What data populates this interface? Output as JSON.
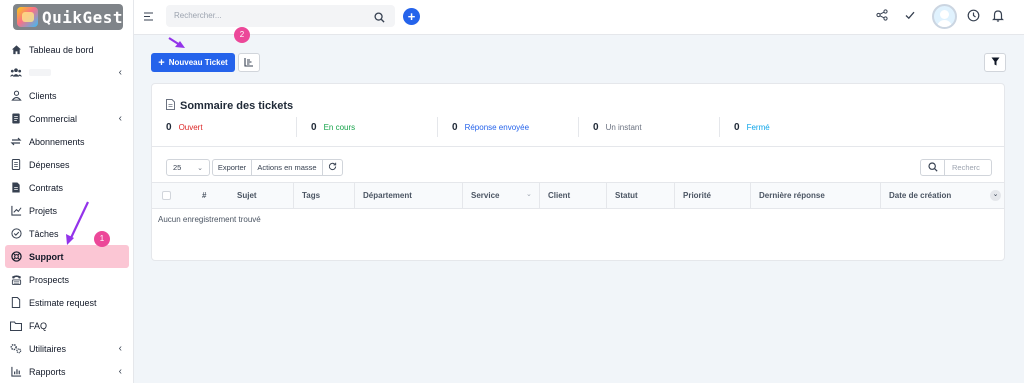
{
  "app": {
    "name": "QuikGest"
  },
  "sidebar": {
    "items": [
      {
        "label": "Tableau de bord",
        "icon": "home-icon"
      },
      {
        "label": "",
        "icon": "team-icon",
        "chevron": true
      },
      {
        "label": "Clients",
        "icon": "user-icon"
      },
      {
        "label": "Commercial",
        "icon": "document-icon",
        "chevron": true
      },
      {
        "label": "Abonnements",
        "icon": "repeat-icon"
      },
      {
        "label": "Dépenses",
        "icon": "receipt-icon"
      },
      {
        "label": "Contrats",
        "icon": "file-contract-icon"
      },
      {
        "label": "Projets",
        "icon": "chart-icon"
      },
      {
        "label": "Tâches",
        "icon": "check-circle-icon"
      },
      {
        "label": "Support",
        "icon": "lifebuoy-icon",
        "active": true
      },
      {
        "label": "Prospects",
        "icon": "tty-icon"
      },
      {
        "label": "Estimate request",
        "icon": "file-icon"
      },
      {
        "label": "FAQ",
        "icon": "folder-icon"
      },
      {
        "label": "Utilitaires",
        "icon": "cogs-icon",
        "chevron": true
      },
      {
        "label": "Rapports",
        "icon": "bar-chart-icon",
        "chevron": true
      }
    ]
  },
  "topbar": {
    "search_placeholder": "Rechercher..."
  },
  "annotations": {
    "step1": "1",
    "step2": "2"
  },
  "toolbar": {
    "new_ticket_label": "Nouveau Ticket"
  },
  "summary": {
    "title": "Sommaire des tickets",
    "stats": [
      {
        "count": "0",
        "label": "Ouvert",
        "color": "#dc2626"
      },
      {
        "count": "0",
        "label": "En cours",
        "color": "#16a34a"
      },
      {
        "count": "0",
        "label": "Réponse envoyée",
        "color": "#2563eb"
      },
      {
        "count": "0",
        "label": "Un instant",
        "color": "#6b7280"
      },
      {
        "count": "0",
        "label": "Fermé",
        "color": "#0ea5e9"
      }
    ]
  },
  "table_controls": {
    "page_size": "25",
    "export_label": "Exporter",
    "bulk_label": "Actions en masse",
    "search_placeholder": "Recherc"
  },
  "table": {
    "headers": [
      "#",
      "Sujet",
      "Tags",
      "Département",
      "Service",
      "Client",
      "Statut",
      "Priorité",
      "Dernière réponse",
      "Date de création"
    ],
    "empty_message": "Aucun enregistrement trouvé"
  },
  "colors": {
    "accent": "#2563eb",
    "active_bg": "#fbc6d4",
    "badge": "#ec4899",
    "arrow": "#9333ea"
  }
}
